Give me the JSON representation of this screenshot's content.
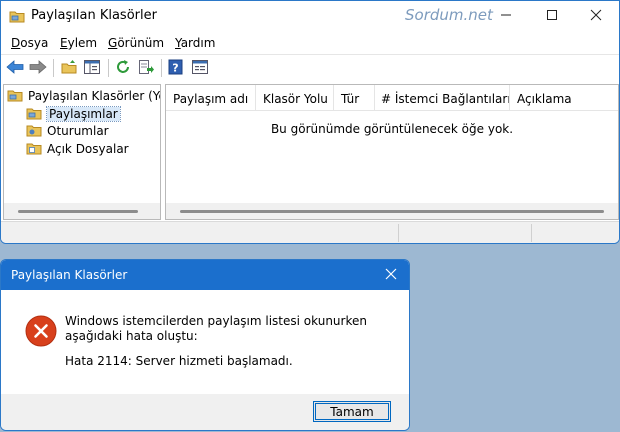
{
  "main_window": {
    "title": "Paylaşılan Klasörler",
    "watermark": "Sordum.net"
  },
  "menu": [
    {
      "accel": "D",
      "rest": "osya"
    },
    {
      "accel": "E",
      "rest": "ylem"
    },
    {
      "accel": "G",
      "rest": "örünüm"
    },
    {
      "accel": "Y",
      "rest": "ardım"
    }
  ],
  "tree": {
    "root": "Paylaşılan Klasörler (Yerel)",
    "items": [
      "Paylaşımlar",
      "Oturumlar",
      "Açık Dosyalar"
    ],
    "selected": "Paylaşımlar"
  },
  "list": {
    "columns": [
      "Paylaşım adı",
      "Klasör Yolu",
      "Tür",
      "# İstemci Bağlantıları",
      "Açıklama"
    ],
    "empty_message": "Bu görünümde görüntülenecek öğe yok."
  },
  "dialog": {
    "title": "Paylaşılan Klasörler",
    "message": "Windows istemcilerden paylaşım listesi okunurken aşağıdaki hata oluştu:",
    "error": "Hata 2114: Server hizmeti başlamadı.",
    "ok_label": "Tamam"
  },
  "colors": {
    "accent": "#1b6fcd",
    "error_red": "#d8401c",
    "desktop": "#9db8d2"
  },
  "icons": {
    "app": "shared-folder-icon",
    "back": "back-arrow-icon",
    "forward": "forward-arrow-icon",
    "error": "error-x-icon"
  }
}
